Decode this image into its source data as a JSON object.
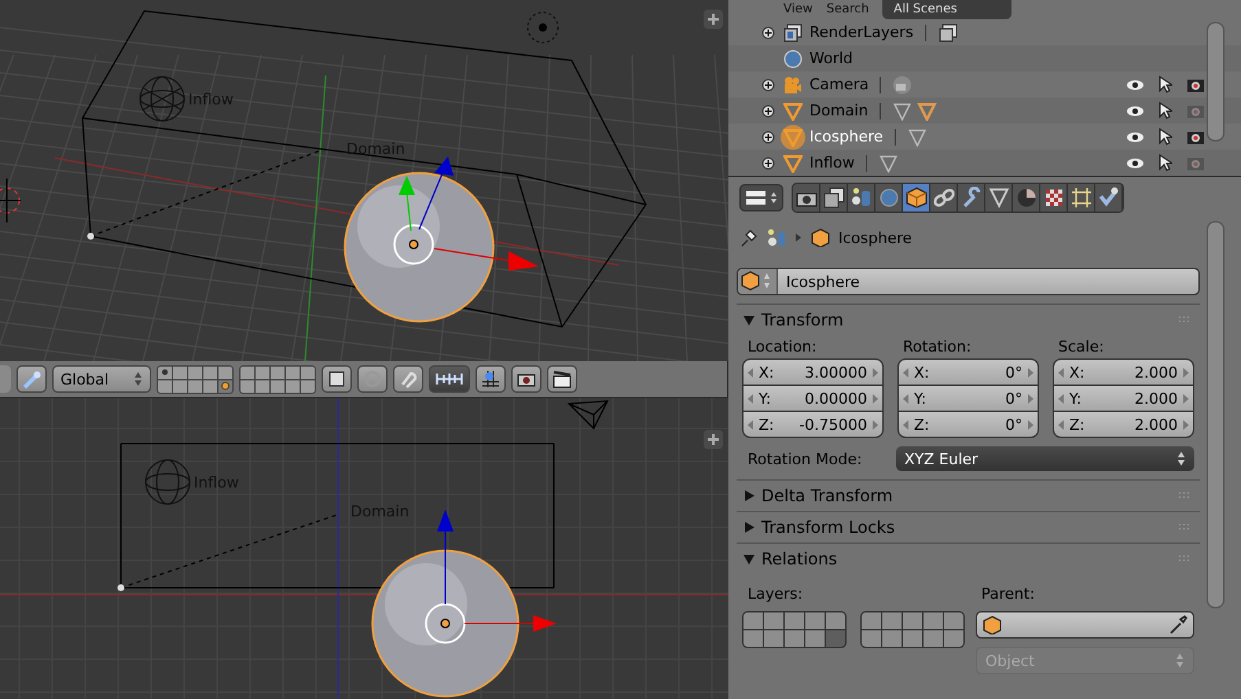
{
  "viewport_top": {
    "labels": [
      {
        "text": "Inflow",
        "kind": "inflow"
      },
      {
        "text": "Domain",
        "kind": "domain"
      }
    ]
  },
  "viewport_header": {
    "orientation": "Global",
    "layers": [
      {
        "used": true,
        "active": false
      },
      {
        "used": false,
        "active": false
      },
      {
        "used": false,
        "active": false
      },
      {
        "used": false,
        "active": false
      },
      {
        "used": false,
        "active": false
      },
      {
        "used": false,
        "active": false
      },
      {
        "used": false,
        "active": false
      },
      {
        "used": false,
        "active": false
      },
      {
        "used": false,
        "active": false
      },
      {
        "used": true,
        "active": true
      },
      {
        "used": false,
        "active": false
      },
      {
        "used": false,
        "active": false
      },
      {
        "used": false,
        "active": false
      },
      {
        "used": false,
        "active": false
      },
      {
        "used": false,
        "active": false
      },
      {
        "used": false,
        "active": false
      },
      {
        "used": false,
        "active": false
      },
      {
        "used": false,
        "active": false
      },
      {
        "used": false,
        "active": false
      },
      {
        "used": false,
        "active": false
      }
    ]
  },
  "viewport_bottom": {
    "labels": [
      {
        "text": "Inflow",
        "kind": "inflow"
      },
      {
        "text": "Domain",
        "kind": "domain"
      }
    ]
  },
  "outliner": {
    "header": {
      "menus": [
        "View",
        "Search"
      ],
      "scene": "All Scenes"
    },
    "items": [
      {
        "name": "RenderLayers",
        "kind": "renderlayers",
        "expandable": true,
        "selected": false,
        "data": [
          {
            "kind": "renderlayers"
          }
        ]
      },
      {
        "name": "World",
        "kind": "world",
        "expandable": false,
        "selected": false
      },
      {
        "name": "Camera",
        "kind": "camera",
        "expandable": true,
        "selected": false,
        "renderable": true,
        "data": [
          {
            "kind": "camera"
          }
        ]
      },
      {
        "name": "Domain",
        "kind": "mesh",
        "expandable": true,
        "selected": false,
        "renderable": false,
        "data": [
          {
            "kind": "mesh"
          },
          {
            "kind": "object"
          }
        ]
      },
      {
        "name": "Icosphere",
        "kind": "mesh",
        "expandable": true,
        "selected": true,
        "renderable": true,
        "data": [
          {
            "kind": "mesh"
          }
        ]
      },
      {
        "name": "Inflow",
        "kind": "mesh",
        "expandable": true,
        "selected": false,
        "renderable": false,
        "data": [
          {
            "kind": "mesh"
          }
        ]
      }
    ]
  },
  "properties": {
    "tabs": [
      {
        "kind": "render",
        "selected": false
      },
      {
        "kind": "layers",
        "selected": false
      },
      {
        "kind": "scene",
        "selected": false
      },
      {
        "kind": "world",
        "selected": false
      },
      {
        "kind": "object",
        "selected": true
      },
      {
        "kind": "constraints",
        "selected": false
      },
      {
        "kind": "modifiers",
        "selected": false
      },
      {
        "kind": "data",
        "selected": false
      },
      {
        "kind": "material",
        "selected": false
      },
      {
        "kind": "texture",
        "selected": false
      },
      {
        "kind": "particles",
        "selected": false
      },
      {
        "kind": "physics",
        "selected": false
      }
    ],
    "breadcrumb": "Icosphere",
    "object_name": "Icosphere",
    "panels": [
      {
        "kind": "transform",
        "title": "Transform",
        "expanded": true,
        "columns": [
          {
            "heading": "Location:",
            "fields": [
              {
                "axis": "X:",
                "value": "3.00000"
              },
              {
                "axis": "Y:",
                "value": "0.00000"
              },
              {
                "axis": "Z:",
                "value": "-0.75000"
              }
            ]
          },
          {
            "heading": "Rotation:",
            "fields": [
              {
                "axis": "X:",
                "value": "0°"
              },
              {
                "axis": "Y:",
                "value": "0°"
              },
              {
                "axis": "Z:",
                "value": "0°"
              }
            ]
          },
          {
            "heading": "Scale:",
            "fields": [
              {
                "axis": "X:",
                "value": "2.000"
              },
              {
                "axis": "Y:",
                "value": "2.000"
              },
              {
                "axis": "Z:",
                "value": "2.000"
              }
            ]
          }
        ],
        "rotation_mode_label": "Rotation Mode:",
        "rotation_mode": "XYZ Euler"
      },
      {
        "kind": "plain",
        "title": "Delta Transform",
        "expanded": false
      },
      {
        "kind": "plain",
        "title": "Transform Locks",
        "expanded": false
      },
      {
        "kind": "relations",
        "title": "Relations",
        "expanded": true,
        "layers_label": "Layers:",
        "layers": [
          false,
          false,
          false,
          false,
          false,
          false,
          false,
          false,
          false,
          true,
          false,
          false,
          false,
          false,
          false,
          false,
          false,
          false,
          false,
          false
        ],
        "parent_label": "Parent:",
        "parent_type": "Object",
        "parent_type_disabled": true
      }
    ]
  }
}
